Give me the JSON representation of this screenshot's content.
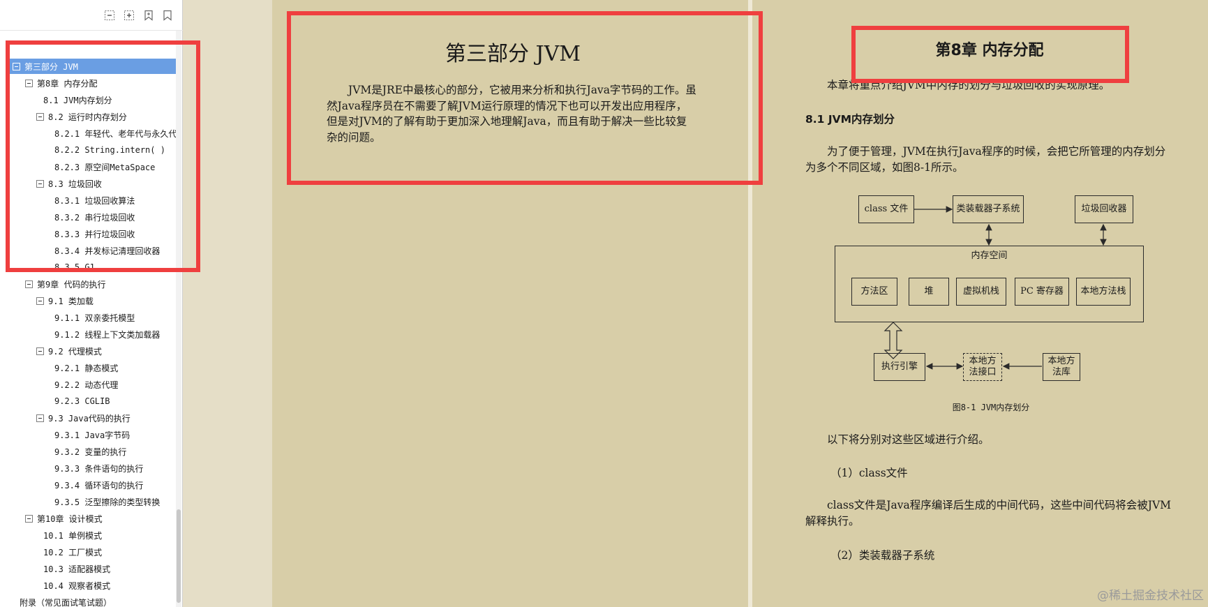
{
  "toolbar": {
    "buttons": [
      {
        "icon": "collapse-all-icon"
      },
      {
        "icon": "expand-all-icon"
      },
      {
        "icon": "add-bookmark-icon"
      },
      {
        "icon": "bookmark-icon"
      }
    ]
  },
  "outline": [
    {
      "label": "第三部分 JVM",
      "selected": true,
      "toggle": true
    },
    {
      "label": "第8章 内存分配",
      "toggle": true
    },
    {
      "label": "8.1 JVM内存划分"
    },
    {
      "label": "8.2 运行时内存划分",
      "toggle": true
    },
    {
      "label": "8.2.1 年轻代、老年代与永久代"
    },
    {
      "label": "8.2.2 String.intern( )"
    },
    {
      "label": "8.2.3 原空间MetaSpace"
    },
    {
      "label": "8.3 垃圾回收",
      "toggle": true
    },
    {
      "label": "8.3.1 垃圾回收算法"
    },
    {
      "label": "8.3.2 串行垃圾回收"
    },
    {
      "label": "8.3.3 并行垃圾回收"
    },
    {
      "label": "8.3.4 并发标记清理回收器"
    },
    {
      "label": "8.3.5 G1"
    },
    {
      "label": "第9章 代码的执行",
      "toggle": true
    },
    {
      "label": "9.1 类加载",
      "toggle": true
    },
    {
      "label": "9.1.1 双亲委托模型"
    },
    {
      "label": "9.1.2 线程上下文类加载器"
    },
    {
      "label": "9.2 代理模式",
      "toggle": true
    },
    {
      "label": "9.2.1 静态模式"
    },
    {
      "label": "9.2.2 动态代理"
    },
    {
      "label": "9.2.3 CGLIB"
    },
    {
      "label": "9.3 Java代码的执行",
      "toggle": true
    },
    {
      "label": "9.3.1 Java字节码"
    },
    {
      "label": "9.3.2 变量的执行"
    },
    {
      "label": "9.3.3 条件语句的执行"
    },
    {
      "label": "9.3.4 循环语句的执行"
    },
    {
      "label": "9.3.5 泛型擦除的类型转换"
    },
    {
      "label": "第10章 设计模式",
      "toggle": true
    },
    {
      "label": "10.1 单例模式"
    },
    {
      "label": "10.2 工厂模式"
    },
    {
      "label": "10.3 适配器模式"
    },
    {
      "label": "10.4 观察者模式"
    },
    {
      "label": "附录（常见面试笔试题）"
    }
  ],
  "left_page": {
    "title": "第三部分  JVM",
    "body": "JVM是JRE中最核心的部分，它被用来分析和执行Java字节码的工作。虽然Java程序员在不需要了解JVM运行原理的情况下也可以开发出应用程序，但是对JVM的了解有助于更加深入地理解Java，而且有助于解决一些比较复杂的问题。"
  },
  "right_page": {
    "chapter_title": "第8章  内存分配",
    "intro": "本章将重点介绍JVM中内存的划分与垃圾回收的实现原理。",
    "section_81": "8.1  JVM内存划分",
    "mgmt": "为了便于管理，JVM在执行Java程序的时候，会把它所管理的内存划分为多个不同区域，如图8-1所示。",
    "figure": {
      "class_file": "class 文件",
      "class_loader": "类装载器子系统",
      "gc": "垃圾回收器",
      "memory": "内存空间",
      "method_area": "方法区",
      "heap": "堆",
      "vm_stack": "虚拟机栈",
      "pc_register": "PC 寄存器",
      "native_stack": "本地方法栈",
      "exec_engine": "执行引擎",
      "native_interface": "本地方\n法接口",
      "native_lib": "本地方\n法库",
      "caption": "图8-1  JVM内存划分"
    },
    "following": "以下将分别对这些区域进行介绍。",
    "h_class": "（1）class文件",
    "p_class": "class文件是Java程序编译后生成的中间代码，这些中间代码将会被JVM解释执行。",
    "h_loader": "（2）类装载器子系统"
  },
  "watermark": "@稀土掘金技术社区",
  "highlight_color": "#ef3f3f"
}
